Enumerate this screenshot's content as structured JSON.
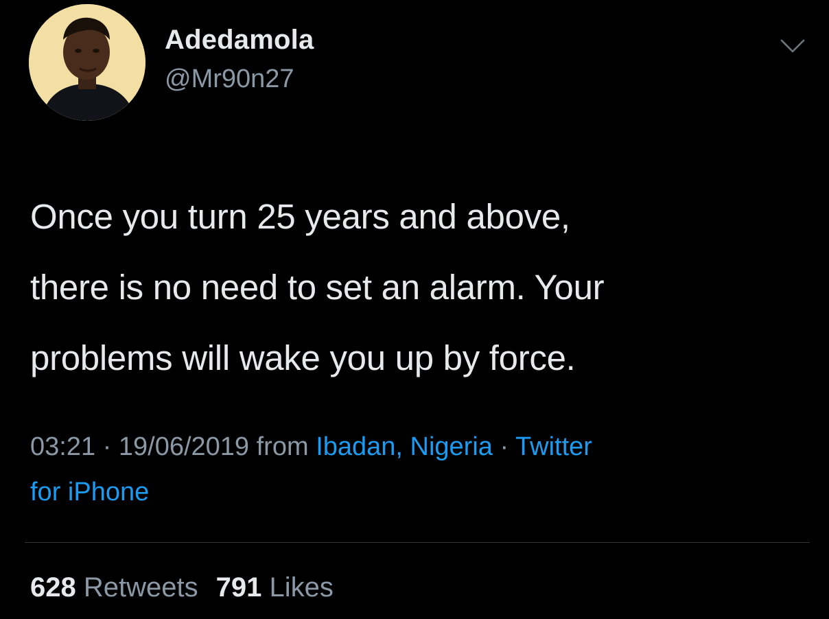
{
  "author": {
    "display_name": "Adedamola",
    "handle": "@Mr90n27",
    "avatar_icon": "profile-photo"
  },
  "menu": {
    "icon": "chevron-down-icon"
  },
  "tweet": {
    "text_lines": [
      "Once you turn 25 years and above,",
      "there is no need to set an alarm. Your",
      "problems will wake you up by force."
    ]
  },
  "meta": {
    "time": "03:21",
    "sep1": " · ",
    "date": "19/06/2019",
    "from": " from ",
    "location": "Ibadan, Nigeria",
    "sep2": " · ",
    "source_line1": "Twitter",
    "source_line2": "for iPhone"
  },
  "stats": {
    "retweets_count": "628",
    "retweets_label": "Retweets",
    "likes_count": "791",
    "likes_label": "Likes"
  },
  "colors": {
    "background": "#000000",
    "text": "#e7e9ea",
    "muted": "#8b98a5",
    "link": "#1d9bf0"
  }
}
